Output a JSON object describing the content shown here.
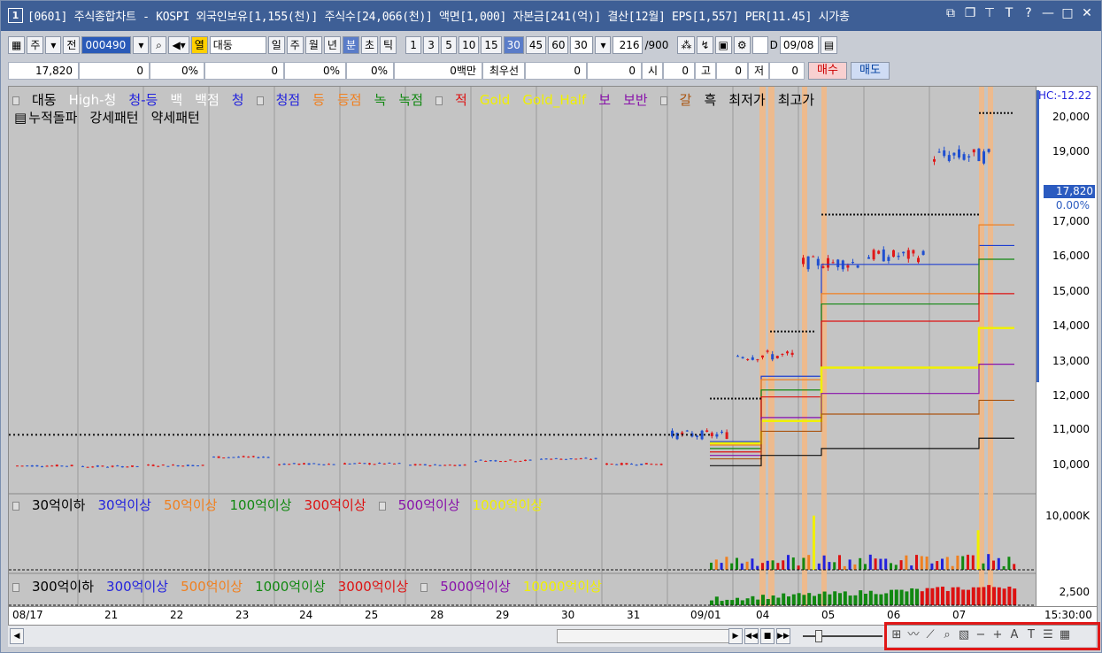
{
  "window": {
    "number": "1",
    "title": "[0601] 주식종합차트 - KOSPI 외국인보유[1,155(천)] 주식수[24,066(천)] 액면[1,000] 자본금[241(억)] 결산[12월] EPS[1,557] PER[11.45] 시가총",
    "icons": [
      "window-restore-icon",
      "window-copy-icon",
      "pin-icon",
      "font-icon",
      "help-icon",
      "minimize-icon",
      "maximize-icon",
      "close-icon"
    ]
  },
  "toolbar": {
    "market": "주",
    "prev": "전",
    "code": "000490",
    "name_badge": "열",
    "name": "대동",
    "periods": [
      "일",
      "주",
      "월",
      "년",
      "분",
      "초",
      "틱"
    ],
    "selected_period": "분",
    "intervals": [
      "1",
      "3",
      "5",
      "10",
      "15",
      "30",
      "45",
      "60"
    ],
    "selected_interval": "30",
    "interval_value": "30",
    "count": "216",
    "total": "/900",
    "date_check": "D",
    "date": "09/08"
  },
  "quote": {
    "price": "17,820",
    "c1": "0",
    "c2": "0%",
    "c3": "0",
    "c4": "0%",
    "c5": "0%",
    "volume": "0백만",
    "best_label": "최우선",
    "best1": "0",
    "best2": "0",
    "open_label": "시",
    "open": "0",
    "high_label": "고",
    "high": "0",
    "low_label": "저",
    "low": "0",
    "buy": "매수",
    "sell": "매도"
  },
  "legend_price": {
    "items": [
      {
        "label": "대동",
        "color": "#000000"
      },
      {
        "label": "High-청",
        "color": "#ffffff"
      },
      {
        "label": "청-등",
        "color": "#2222dd"
      },
      {
        "label": "백",
        "color": "#ffffff"
      },
      {
        "label": "백점",
        "color": "#ffffff"
      },
      {
        "label": "청",
        "color": "#2222dd"
      },
      {
        "label": "청점",
        "color": "#2222dd"
      },
      {
        "label": "등",
        "color": "#f08020"
      },
      {
        "label": "등점",
        "color": "#f08020"
      },
      {
        "label": "녹",
        "color": "#118811"
      },
      {
        "label": "녹점",
        "color": "#118811"
      },
      {
        "label": "적",
        "color": "#dd1111"
      },
      {
        "label": "Gold",
        "color": "#f0f000"
      },
      {
        "label": "Gold_Half",
        "color": "#f0f000"
      },
      {
        "label": "보",
        "color": "#8811aa"
      },
      {
        "label": "보반",
        "color": "#8811aa"
      },
      {
        "label": "갈",
        "color": "#aa5511"
      },
      {
        "label": "흑",
        "color": "#000000"
      },
      {
        "label": "최저가",
        "color": "#000000"
      },
      {
        "label": "최고가",
        "color": "#000000"
      }
    ],
    "line2": [
      "누적돌파",
      "강세패턴",
      "약세패턴"
    ]
  },
  "legend_vol1": [
    {
      "label": "30억이하",
      "color": "#000000"
    },
    {
      "label": "30억이상",
      "color": "#2222dd"
    },
    {
      "label": "50억이상",
      "color": "#f08020"
    },
    {
      "label": "100억이상",
      "color": "#118811"
    },
    {
      "label": "300억이상",
      "color": "#dd1111"
    },
    {
      "label": "500억이상",
      "color": "#8811aa"
    },
    {
      "label": "1000억이상",
      "color": "#f0f000"
    }
  ],
  "legend_vol2": [
    {
      "label": "300억이하",
      "color": "#000000"
    },
    {
      "label": "300억이상",
      "color": "#2222dd"
    },
    {
      "label": "500억이상",
      "color": "#f08020"
    },
    {
      "label": "1000억이상",
      "color": "#118811"
    },
    {
      "label": "3000억이상",
      "color": "#dd1111"
    },
    {
      "label": "5000억이상",
      "color": "#8811aa"
    },
    {
      "label": "10000억이상",
      "color": "#f0f000"
    }
  ],
  "axis": {
    "hc_label": "HC:-12.22",
    "price_ticks": [
      "20,000",
      "19,000",
      "17,000",
      "16,000",
      "15,000",
      "14,000",
      "13,000",
      "12,000",
      "11,000",
      "10,000"
    ],
    "current_price": "17,820",
    "current_pct": "0.00%",
    "vol1_tick": "10,000K",
    "vol2_tick": "2,500",
    "time_label": "15:30:00"
  },
  "dates": [
    "08/17",
    "21",
    "22",
    "23",
    "24",
    "25",
    "28",
    "29",
    "30",
    "31",
    "09/01",
    "04",
    "05",
    "06",
    "07"
  ],
  "chart_data": {
    "type": "candlestick",
    "title": "",
    "y_range": [
      9700,
      20500
    ],
    "note": "price levels in KRW",
    "sessions": [
      {
        "label": "08/17",
        "level": 10000
      },
      {
        "label": "21",
        "level": 9980
      },
      {
        "label": "22",
        "level": 10010
      },
      {
        "label": "23",
        "level": 10250
      },
      {
        "label": "24",
        "level": 10050
      },
      {
        "label": "25",
        "level": 10060
      },
      {
        "label": "28",
        "level": 10020
      },
      {
        "label": "29",
        "level": 10150
      },
      {
        "label": "30",
        "level": 10200
      },
      {
        "label": "31",
        "level": 10050
      },
      {
        "label": "09/01",
        "level": 10900
      },
      {
        "label": "04",
        "level": 13200
      },
      {
        "label": "05",
        "level": 15900
      },
      {
        "label": "06",
        "level": 16100
      },
      {
        "label": "07",
        "level": 19000
      }
    ]
  }
}
